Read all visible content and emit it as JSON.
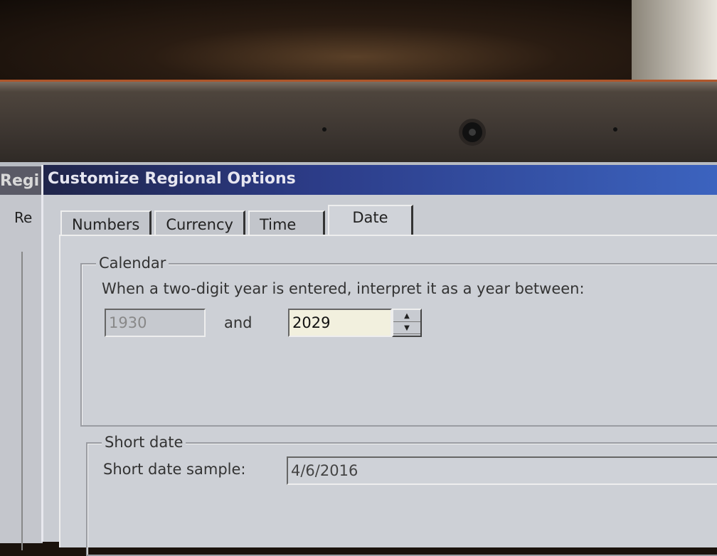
{
  "dialog": {
    "title": "Customize Regional Options",
    "background_window_title": "Regi",
    "background_tab": "Re"
  },
  "tabs": [
    {
      "label": "Numbers"
    },
    {
      "label": "Currency"
    },
    {
      "label": "Time"
    },
    {
      "label": "Date",
      "active": true
    }
  ],
  "calendar": {
    "group_label": "Calendar",
    "description": "When a two-digit year is entered, interpret it as a year between:",
    "start_year": "1930",
    "and_label": "and",
    "end_year": "2029"
  },
  "short_date": {
    "group_label": "Short date",
    "sample_label": "Short date sample:",
    "sample_value": "4/6/2016"
  }
}
